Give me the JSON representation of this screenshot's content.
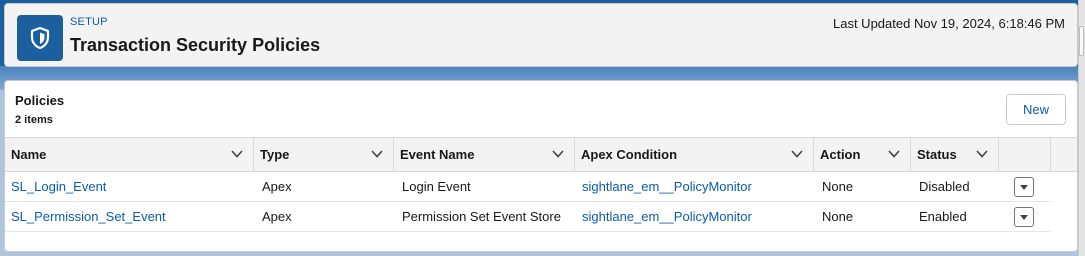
{
  "header": {
    "eyebrow": "SETUP",
    "title": "Transaction Security Policies",
    "last_updated": "Last Updated Nov 19, 2024, 6:18:46 PM"
  },
  "list": {
    "title": "Policies",
    "count": "2 items",
    "new_label": "New",
    "columns": [
      "Name",
      "Type",
      "Event Name",
      "Apex Condition",
      "Action",
      "Status"
    ],
    "rows": [
      {
        "name": "SL_Login_Event",
        "type": "Apex",
        "event_name": "Login Event",
        "apex_condition": "sightlane_em__PolicyMonitor",
        "action": "None",
        "status": "Disabled"
      },
      {
        "name": "SL_Permission_Set_Event",
        "type": "Apex",
        "event_name": "Permission Set Event Store",
        "apex_condition": "sightlane_em__PolicyMonitor",
        "action": "None",
        "status": "Enabled"
      }
    ]
  },
  "colors": {
    "brand": "#1b5f9e",
    "link": "#0b5cab",
    "background": "#b0c4df"
  },
  "icons": {
    "setup": "shield-icon",
    "sort": "chevron-down-icon",
    "row_menu": "dropdown-caret-icon"
  }
}
